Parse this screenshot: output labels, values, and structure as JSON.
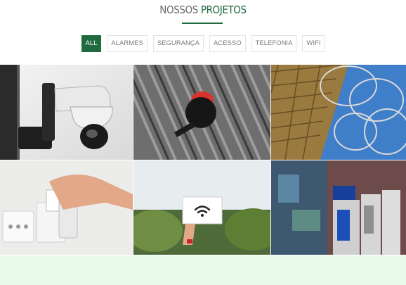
{
  "section": {
    "title_part1": "NOSSOS",
    "title_part2": "PROJETOS"
  },
  "filters": [
    {
      "label": "ALL",
      "active": true
    },
    {
      "label": "ALARMES",
      "active": false
    },
    {
      "label": "SEGURANÇA",
      "active": false
    },
    {
      "label": "ACESSO",
      "active": false
    },
    {
      "label": "TELEFONIA",
      "active": false
    },
    {
      "label": "WIFI",
      "active": false
    }
  ],
  "colors": {
    "accent": "#1f6a3f",
    "footer_band": "#eafbea"
  },
  "projects": [
    {
      "image": "security-camera-photo"
    },
    {
      "image": "alarm-siren-photo"
    },
    {
      "image": "razor-wire-fence-photo"
    },
    {
      "image": "access-card-reader-photo"
    },
    {
      "image": "wifi-sign-photo"
    },
    {
      "image": "payphones-photo"
    }
  ]
}
